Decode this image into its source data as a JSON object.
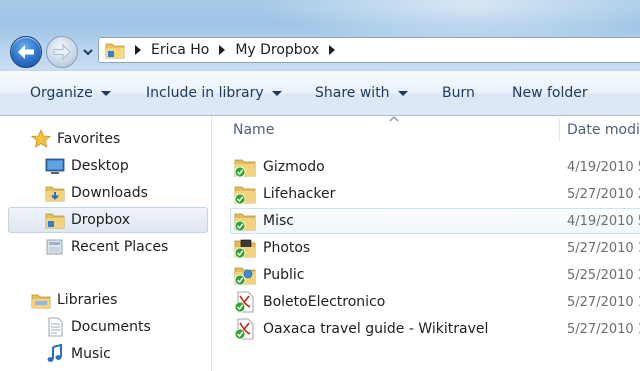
{
  "address_bar": {
    "crumbs": [
      "Erica Ho",
      "My Dropbox"
    ]
  },
  "toolbar": {
    "organize": "Organize",
    "include_in_library": "Include in library",
    "share_with": "Share with",
    "burn": "Burn",
    "new_folder": "New folder"
  },
  "nav_pane": {
    "favorites": "Favorites",
    "favorites_items": [
      "Desktop",
      "Downloads",
      "Dropbox",
      "Recent Places"
    ],
    "libraries": "Libraries",
    "libraries_items": [
      "Documents",
      "Music"
    ]
  },
  "columns": {
    "name": "Name",
    "date_modified": "Date modifi"
  },
  "files": [
    {
      "name": "Gizmodo",
      "date": "4/19/2010 5",
      "icon": "dropbox-folder-icon"
    },
    {
      "name": "Lifehacker",
      "date": "5/27/2010 2",
      "icon": "dropbox-folder-icon"
    },
    {
      "name": "Misc",
      "date": "4/19/2010 5",
      "icon": "dropbox-folder-icon"
    },
    {
      "name": "Photos",
      "date": "5/27/2010 1",
      "icon": "dropbox-photos-folder-icon"
    },
    {
      "name": "Public",
      "date": "5/25/2010 3",
      "icon": "dropbox-public-folder-icon"
    },
    {
      "name": "BoletoElectronico",
      "date": "5/27/2010 1",
      "icon": "pdf-file-icon"
    },
    {
      "name": "Oaxaca travel guide - Wikitravel",
      "date": "5/27/2010 1",
      "icon": "pdf-file-icon"
    }
  ],
  "colors": {
    "chrome_blue": "#a9cbe8",
    "toolbar_text": "#1e395b",
    "column_header_text": "#4c607a",
    "date_text": "#6d6d6d",
    "sync_check_green": "#2fa52f"
  }
}
